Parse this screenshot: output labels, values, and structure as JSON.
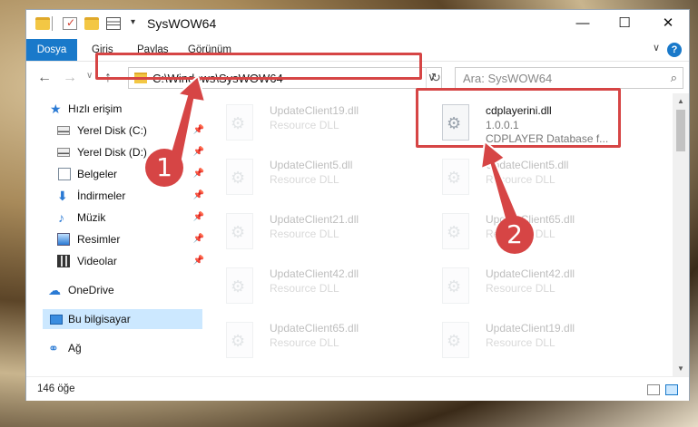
{
  "window": {
    "title": "SysWOW64",
    "dropdown_glyph": "▾",
    "minimize_glyph": "—",
    "maximize_glyph": "☐",
    "close_glyph": "✕"
  },
  "ribbon": {
    "tabs": [
      "Dosya",
      "Giriş",
      "Paylaş",
      "Görünüm"
    ],
    "help_glyph": "?",
    "collapse_glyph": "∨"
  },
  "address": {
    "back_glyph": "←",
    "forward_glyph": "→",
    "recent_glyph": "∨",
    "up_glyph": "↑",
    "path": "C:\\Windows\\SysWOW64",
    "chevron_glyph": "∨",
    "refresh_glyph": "↻",
    "search_placeholder": "Ara: SysWOW64",
    "search_glyph": "⌕"
  },
  "nav": {
    "pin_glyph": "📌",
    "items": [
      {
        "label": "Hızlı erişim",
        "icon": "star-icon",
        "glyph": "★"
      },
      {
        "label": "Yerel Disk (C:)",
        "icon": "disk-icon",
        "pinned": true
      },
      {
        "label": "Yerel Disk (D:)",
        "icon": "disk-icon",
        "pinned": true
      },
      {
        "label": "Belgeler",
        "icon": "document-icon",
        "pinned": true
      },
      {
        "label": "İndirmeler",
        "icon": "download-icon",
        "glyph": "⬇",
        "pinned": true
      },
      {
        "label": "Müzik",
        "icon": "music-icon",
        "glyph": "♪",
        "pinned": true
      },
      {
        "label": "Resimler",
        "icon": "picture-icon",
        "pinned": true
      },
      {
        "label": "Videolar",
        "icon": "video-icon",
        "pinned": true
      },
      {
        "label": "OneDrive",
        "icon": "cloud-icon",
        "glyph": "☁"
      },
      {
        "label": "Bu bilgisayar",
        "icon": "computer-icon",
        "selected": true
      },
      {
        "label": "Ağ",
        "icon": "network-icon",
        "glyph": "⚭"
      }
    ]
  },
  "files": {
    "highlighted": {
      "name": "cdplayerini.dll",
      "version": "1.0.0.1",
      "description": "CDPLAYER Database f..."
    },
    "left_column": [
      {
        "name": "UpdateClient19.dll",
        "desc": "Resource DLL"
      },
      {
        "name": "UpdateClient5.dll",
        "desc": "Resource DLL"
      },
      {
        "name": "UpdateClient21.dll",
        "desc": "Resource DLL"
      },
      {
        "name": "UpdateClient42.dll",
        "desc": "Resource DLL"
      },
      {
        "name": "UpdateClient65.dll",
        "desc": "Resource DLL"
      }
    ],
    "right_column": [
      {
        "name": "UpdateClient5.dll",
        "desc": "Resource DLL"
      },
      {
        "name": "UpdateClient65.dll",
        "desc": "Resource DLL"
      },
      {
        "name": "UpdateClient42.dll",
        "desc": "Resource DLL"
      },
      {
        "name": "UpdateClient19.dll",
        "desc": "Resource DLL"
      }
    ]
  },
  "scrollbar": {
    "up_glyph": "▲",
    "down_glyph": "▼"
  },
  "status": {
    "item_count": "146 öğe"
  },
  "callouts": {
    "one": "1",
    "two": "2"
  },
  "colors": {
    "accent": "#1979ca",
    "callout_red": "#d64545",
    "selection": "#cce8ff"
  }
}
